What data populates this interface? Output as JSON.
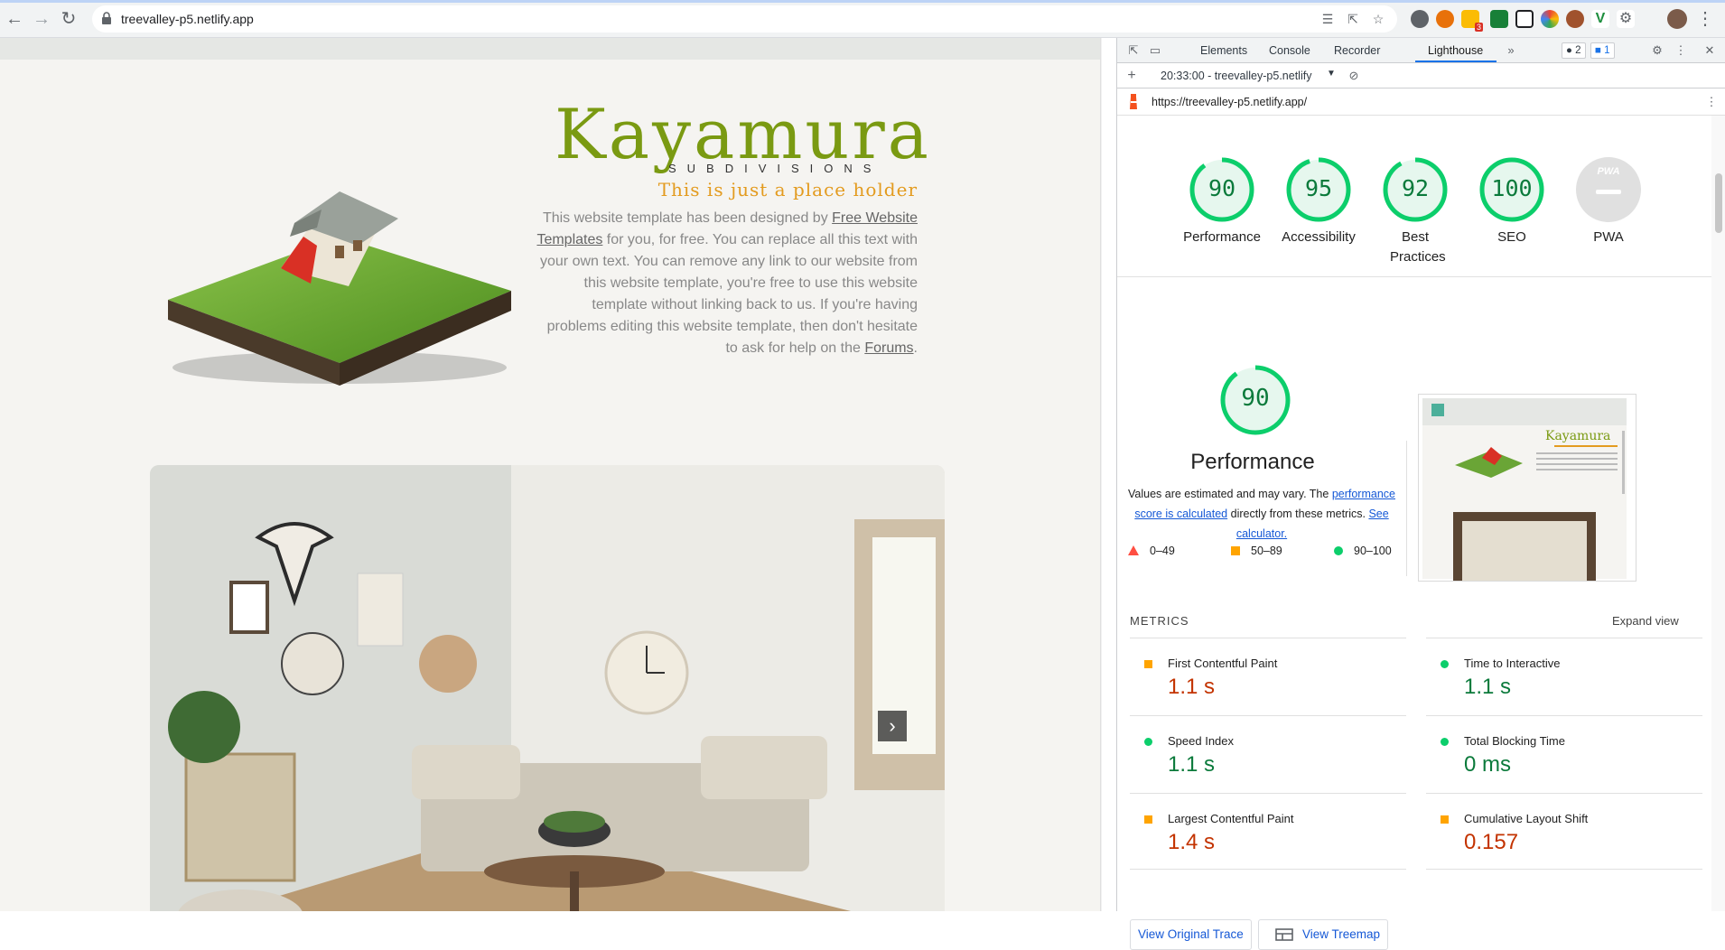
{
  "browser": {
    "url": "treevalley-p5.netlify.app",
    "extension_badge": "3"
  },
  "site": {
    "brand_title": "Kayamura",
    "brand_subtitle": "SUBDIVISIONS",
    "tagline": "This is just a place holder",
    "desc_part1": "This website template has been designed by ",
    "desc_link1": "Free Website Templates",
    "desc_part2": " for you, for free. You can replace all this text with your own text. You can remove any link to our website from this website template, you're free to use this website template without linking back to us. If you're having problems editing this website template, then don't hesitate to ask for help on the ",
    "desc_link2": "Forums",
    "desc_part3": ".",
    "slider_next": "›"
  },
  "devtools": {
    "tabs": [
      "Elements",
      "Console",
      "Recorder",
      "Lighthouse"
    ],
    "active_tab": "Lighthouse",
    "errors_badge": "2",
    "messages_badge": "1",
    "report_label": "20:33:00 - treevalley-p5.netlify",
    "report_url": "https://treevalley-p5.netlify.app/"
  },
  "lighthouse": {
    "scores": [
      {
        "label": "Performance",
        "value": "90",
        "score": 90
      },
      {
        "label": "Accessibility",
        "value": "95",
        "score": 95
      },
      {
        "label": "Best Practices",
        "value": "92",
        "score": 92
      },
      {
        "label": "SEO",
        "value": "100",
        "score": 100
      },
      {
        "label": "PWA",
        "value": "PWA",
        "score": null
      }
    ],
    "perf_value": "90",
    "perf_title": "Performance",
    "note_part1": "Values are estimated and may vary. The ",
    "note_link1": "performance score is calculated",
    "note_part2": " directly from these metrics. ",
    "note_link2": "See calculator.",
    "legend": [
      "0–49",
      "50–89",
      "90–100"
    ],
    "metrics_title": "METRICS",
    "expand_view": "Expand view",
    "metrics": [
      {
        "name": "First Contentful Paint",
        "value": "1.1 s",
        "status": "orange"
      },
      {
        "name": "Time to Interactive",
        "value": "1.1 s",
        "status": "green"
      },
      {
        "name": "Speed Index",
        "value": "1.1 s",
        "status": "green"
      },
      {
        "name": "Total Blocking Time",
        "value": "0 ms",
        "status": "green"
      },
      {
        "name": "Largest Contentful Paint",
        "value": "1.4 s",
        "status": "orange"
      },
      {
        "name": "Cumulative Layout Shift",
        "value": "0.157",
        "status": "orange"
      }
    ],
    "btn_trace": "View Original Trace",
    "btn_treemap": "View Treemap",
    "colors": {
      "pass": "#0cce6b",
      "average": "#ffa400",
      "fail": "#ff4e42"
    }
  }
}
